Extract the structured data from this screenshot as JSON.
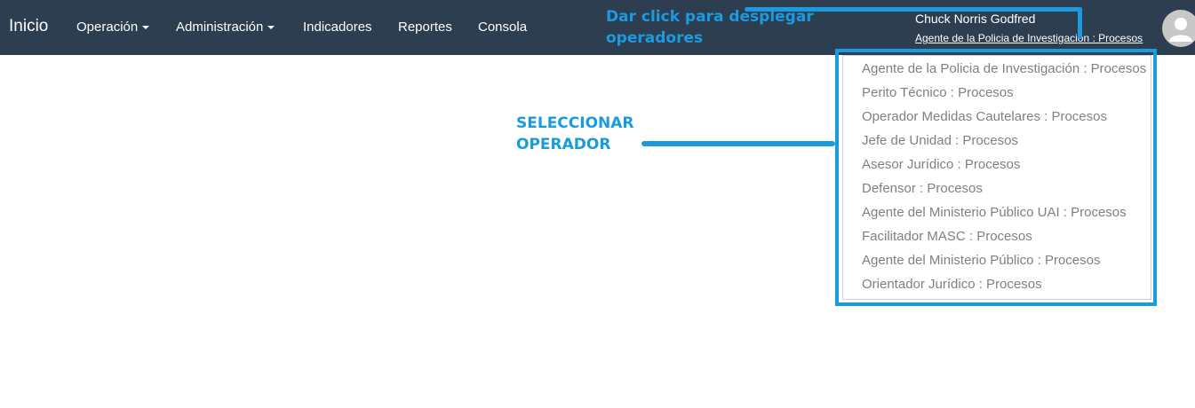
{
  "navbar": {
    "brand": "Inicio",
    "items": [
      {
        "label": "Operación",
        "dropdown": true
      },
      {
        "label": "Administración",
        "dropdown": true
      },
      {
        "label": "Indicadores",
        "dropdown": false
      },
      {
        "label": "Reportes",
        "dropdown": false
      },
      {
        "label": "Consola",
        "dropdown": false
      }
    ],
    "user": {
      "name": "Chuck Norris Godfred",
      "role": "Agente de la Policia de Investigación : Procesos",
      "avatar_icon": "user-avatar-icon"
    }
  },
  "annotations": {
    "top_line1": "Dar click para desplegar",
    "top_line2": "operadores",
    "side_line1": "SELECCIONAR",
    "side_line2": "OPERADOR",
    "color": "#1a9be0"
  },
  "dropdown": {
    "items": [
      "Agente de la Policia de Investigación : Procesos",
      "Perito Técnico : Procesos",
      "Operador Medidas Cautelares : Procesos",
      "Jefe de Unidad : Procesos",
      "Asesor Jurídico : Procesos",
      "Defensor : Procesos",
      "Agente del Ministerio Público UAI : Procesos",
      "Facilitador MASC : Procesos",
      "Agente del Ministerio Público : Procesos",
      "Orientador Jurídico : Procesos"
    ]
  },
  "colors": {
    "navbar_bg": "#2c3e50",
    "annotation": "#1a9be0",
    "dropdown_text": "#808080"
  }
}
